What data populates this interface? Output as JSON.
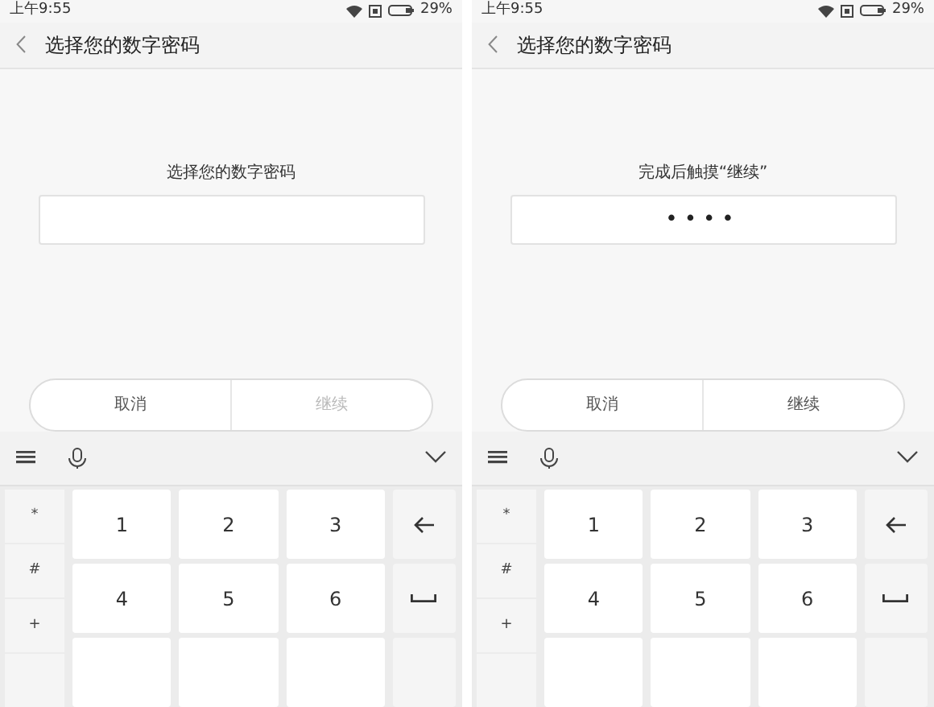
{
  "screens": [
    {
      "status_bar": {
        "time": "上午9:55",
        "battery": "29%"
      },
      "title": "选择您的数字密码",
      "prompt": "选择您的数字密码",
      "buttons": [
        {
          "label": "取消",
          "disabled": false
        },
        {
          "label": "继续",
          "disabled": true
        }
      ],
      "keyboard": {
        "symbol_keys": [
          "*",
          "#",
          "+"
        ],
        "number_keys": [
          "1",
          "2",
          "3",
          "4",
          "5",
          "6"
        ]
      }
    },
    {
      "status_bar": {
        "time": "上午9:55",
        "battery": "29%"
      },
      "title": "选择您的数字密码",
      "prompt": "完成后触摸“继续”",
      "password_field": {
        "value": "••••"
      },
      "buttons": [
        {
          "label": "取消",
          "disabled": false
        },
        {
          "label": "继续",
          "disabled": false
        }
      ],
      "keyboard": {
        "symbol_keys": [
          "*",
          "#",
          "+"
        ],
        "number_keys": [
          "1",
          "2",
          "3",
          "4",
          "5",
          "6"
        ]
      }
    }
  ]
}
